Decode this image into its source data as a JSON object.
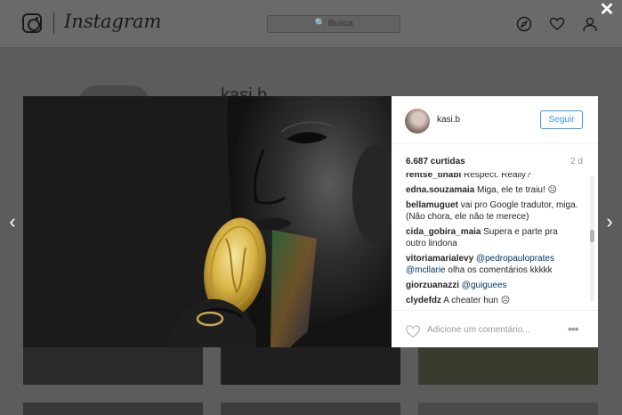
{
  "header": {
    "wordmark": "Instagram",
    "search_placeholder": "🔍 Busca",
    "icons": [
      "camera-logo-icon",
      "compass-icon",
      "heart-icon",
      "profile-icon"
    ]
  },
  "profile_bg": {
    "username": "kasi.b"
  },
  "navigation": {
    "close": "✕",
    "prev": "‹",
    "next": "›"
  },
  "post": {
    "username": "kasi.b",
    "follow_label": "Seguir",
    "likes": "6.687 curtidas",
    "age": "2 d",
    "comments": [
      {
        "user": "rentse_tinabi",
        "text": "Respect. Really?"
      },
      {
        "user": "edna.souzamaia",
        "text": "Miga, ele te traiu! ☹"
      },
      {
        "user": "bellamuguet",
        "text": "vai pro Google tradutor, miga. (Não chora, ele não te merece)"
      },
      {
        "user": "cida_gobira_maia",
        "text": "Supera e parte pra outro lindona"
      },
      {
        "user": "vitoriamarialevy",
        "mention1": "@pedropauloprates",
        "mention2": "@mcllarie",
        "text": "olha os comentários kkkkk"
      },
      {
        "user": "giorzuanazzi",
        "mention1": "@guiguees",
        "text": ""
      },
      {
        "user": "clydefdz",
        "text": "A cheater hun ☹"
      }
    ],
    "comment_placeholder": "Adicione um comentário...",
    "more_label": "•••"
  }
}
